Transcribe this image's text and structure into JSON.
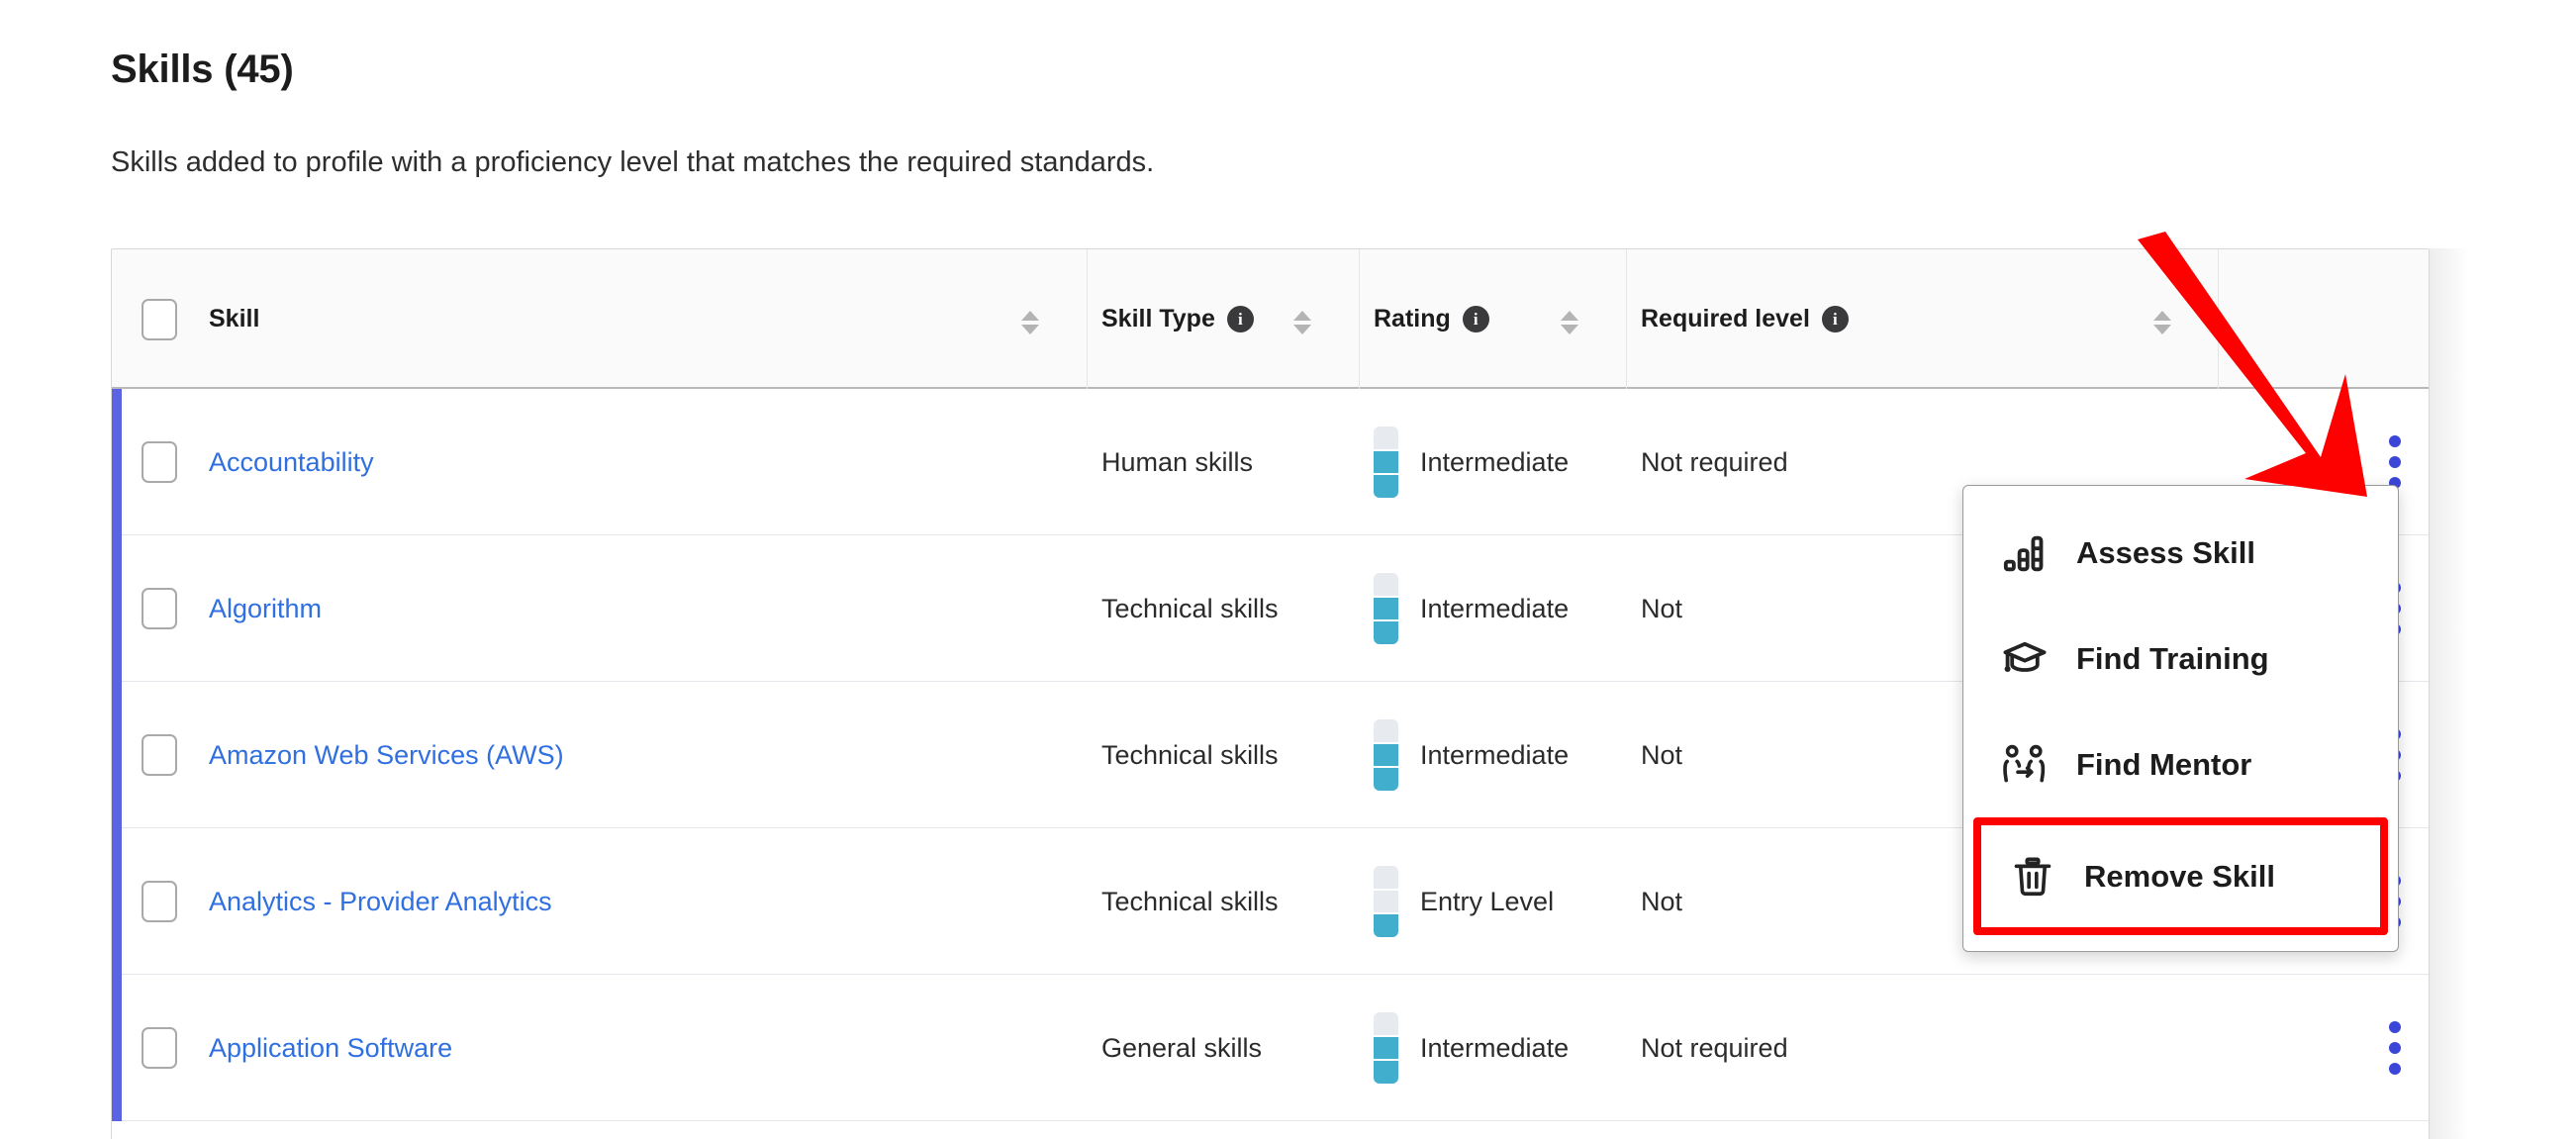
{
  "header": {
    "title": "Skills (45)",
    "subtitle": "Skills added to profile with a proficiency level that matches the required standards."
  },
  "table": {
    "columns": [
      {
        "label": "Skill",
        "has_info": false,
        "sortable": true
      },
      {
        "label": "Skill Type",
        "has_info": true,
        "sortable": true,
        "info_icon": "info-icon"
      },
      {
        "label": "Rating",
        "has_info": true,
        "sortable": true,
        "info_icon": "info-icon"
      },
      {
        "label": "Required level",
        "has_info": true,
        "sortable": true,
        "info_icon": "info-icon"
      }
    ],
    "select_all_checkbox": {
      "checked": false
    },
    "rows": [
      {
        "skill": "Accountability",
        "skill_type": "Human skills",
        "rating": "Intermediate",
        "rating_level": 2,
        "rating_max": 3,
        "required_level": "Not required",
        "required_level_truncated": false,
        "checked": false
      },
      {
        "skill": "Algorithm",
        "skill_type": "Technical skills",
        "rating": "Intermediate",
        "rating_level": 2,
        "rating_max": 3,
        "required_level": "Not",
        "required_level_truncated": true,
        "checked": false
      },
      {
        "skill": "Amazon Web Services (AWS)",
        "skill_type": "Technical skills",
        "rating": "Intermediate",
        "rating_level": 2,
        "rating_max": 3,
        "required_level": "Not",
        "required_level_truncated": true,
        "checked": false
      },
      {
        "skill": "Analytics - Provider Analytics",
        "skill_type": "Technical skills",
        "rating": "Entry Level",
        "rating_level": 1,
        "rating_max": 3,
        "required_level": "Not",
        "required_level_truncated": true,
        "checked": false
      },
      {
        "skill": "Application Software",
        "skill_type": "General skills",
        "rating": "Intermediate",
        "rating_level": 2,
        "rating_max": 3,
        "required_level": "Not required",
        "required_level_truncated": false,
        "checked": false
      }
    ]
  },
  "context_menu": {
    "items": [
      {
        "label": "Assess Skill",
        "icon": "bar-chart-icon",
        "highlighted": false
      },
      {
        "label": "Find Training",
        "icon": "graduation-cap-icon",
        "highlighted": false
      },
      {
        "label": "Find Mentor",
        "icon": "mentor-people-icon",
        "highlighted": false
      },
      {
        "label": "Remove Skill",
        "icon": "trash-icon",
        "highlighted": true
      }
    ]
  },
  "annotation": {
    "arrow_color": "#fd0000",
    "highlight_box_color": "#fd0000",
    "points_at": "row-kebab-menu"
  },
  "colors": {
    "row_accent": "#5a63e2",
    "link": "#2f6fe0",
    "kebab_dot": "#3b46d8",
    "meter_filled": "#41aecd",
    "meter_empty": "#e7eaee",
    "header_bg": "#fafafa",
    "info_badge": "#3a3a3c"
  }
}
